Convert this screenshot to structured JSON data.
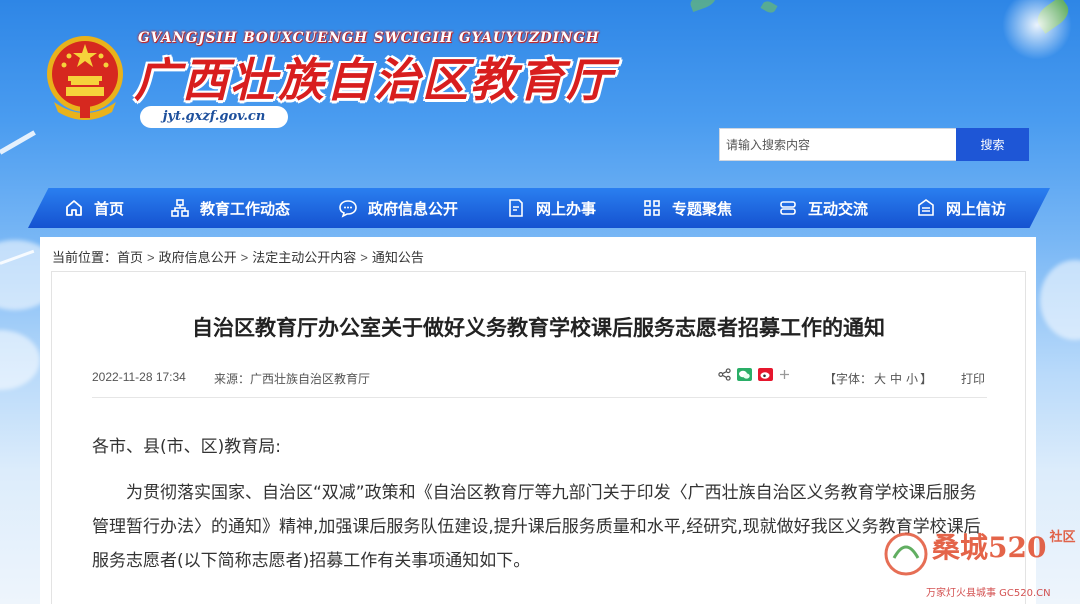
{
  "header": {
    "latin_title": "GVANGJSIH BOUXCUENGH SWCIGIH GYAUYUZDINGH",
    "cn_title": "广西壮族自治区教育厅",
    "site_url": "jyt.gxzf.gov.cn"
  },
  "search": {
    "placeholder": "请输入搜索内容",
    "button_label": "搜索"
  },
  "nav": {
    "items": [
      {
        "label": "首页",
        "icon": "home-icon"
      },
      {
        "label": "教育工作动态",
        "icon": "org-chart-icon"
      },
      {
        "label": "政府信息公开",
        "icon": "chat-bubble-icon"
      },
      {
        "label": "网上办事",
        "icon": "edit-document-icon"
      },
      {
        "label": "专题聚焦",
        "icon": "grid-icon"
      },
      {
        "label": "互动交流",
        "icon": "exchange-icon"
      },
      {
        "label": "网上信访",
        "icon": "letter-box-icon"
      }
    ]
  },
  "breadcrumb": {
    "prefix": "当前位置：",
    "items": [
      "首页",
      "政府信息公开",
      "法定主动公开内容",
      "通知公告"
    ],
    "separator": ">"
  },
  "article": {
    "title": "自治区教育厅办公室关于做好义务教育学校课后服务志愿者招募工作的通知",
    "date": "2022-11-28 17:34",
    "source": "来源：广西壮族自治区教育厅",
    "font_size_label_open": "【字体：",
    "font_sizes": [
      "大",
      "中",
      "小"
    ],
    "font_size_label_close": "】",
    "print_label": "打印",
    "salutation": "各市、县(市、区)教育局:",
    "paragraph_1": "为贯彻落实国家、自治区“双减”政策和《自治区教育厅等九部门关于印发〈广西壮族自治区义务教育学校课后服务管理暂行办法〉的通知》精神,加强课后服务队伍建设,提升课后服务质量和水平,经研究,现就做好我区义务教育学校课后服务志愿者(以下简称志愿者)招募工作有关事项通知如下。"
  },
  "share_icons": [
    "share-icon",
    "wechat-icon",
    "weibo-icon",
    "plus-icon"
  ],
  "watermark": {
    "main": "桑城520",
    "side": "社区",
    "sub": "万家灯火县城事 GC520.CN"
  },
  "colors": {
    "nav_blue": "#1552d0",
    "search_button": "#1e56d6",
    "title_red": "#d81e1e"
  }
}
